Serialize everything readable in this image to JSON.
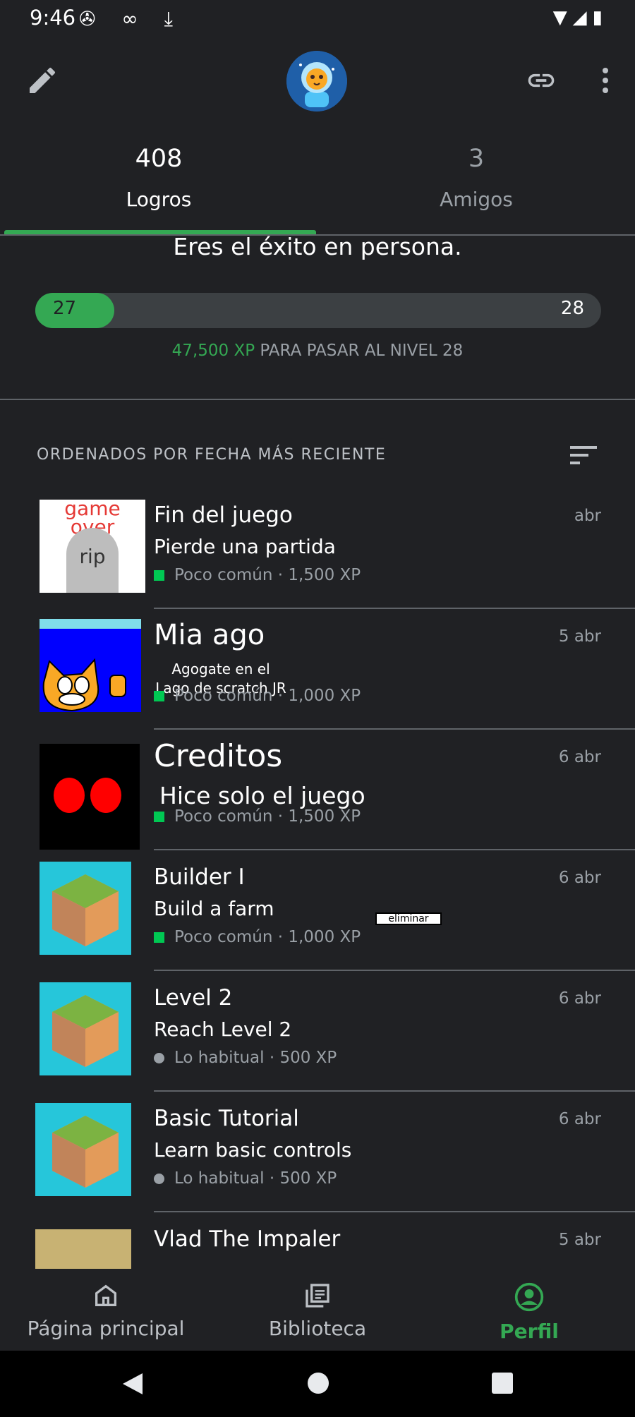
{
  "status_bar": {
    "time": "9:46",
    "left_icons": "✇ ∞ ⤓",
    "right_icons": "▼◢▮"
  },
  "app_bar": {
    "icons": [
      "edit-icon",
      "avatar",
      "link-icon",
      "more-vert-icon"
    ]
  },
  "tabs": [
    {
      "count": "408",
      "label": "Logros",
      "selected": true
    },
    {
      "count": "3",
      "label": "Amigos",
      "selected": false
    }
  ],
  "level": {
    "tagline": "Eres el éxito en persona.",
    "current": "27",
    "next": "28",
    "progress_fraction": 0.14,
    "xp_value": "47,500 XP",
    "xp_text": " PARA PASAR AL NIVEL 28"
  },
  "sort": {
    "label": "ORDENADOS POR FECHA MÁS RECIENTE"
  },
  "achievements": [
    {
      "title": "Fin del juego",
      "desc": "Pierde una partida",
      "rarity": "Poco común · 1,500 XP",
      "date": "abr",
      "thumb_text": "game over",
      "thumb_text2": "rip"
    },
    {
      "title": "Mia ago",
      "desc": "Agogate en el Lago de scratch JR",
      "rarity": "Poco común · 1,000 XP",
      "date": "5 abr"
    },
    {
      "title": "Creditos",
      "desc": "Hice solo el juego",
      "rarity": "Poco común · 1,500 XP",
      "date": "6 abr"
    },
    {
      "title": "Builder I",
      "desc": "Build a farm",
      "rarity": "Poco común · 1,000 XP",
      "date": "6 abr",
      "extra_label": "eliminar"
    },
    {
      "title": "Level 2",
      "desc": "Reach Level 2",
      "rarity": "Lo habitual · 500 XP",
      "date": "6 abr"
    },
    {
      "title": "Basic Tutorial",
      "desc": "Learn basic controls",
      "rarity": "Lo habitual · 500 XP",
      "date": "6 abr"
    },
    {
      "title": "Vlad The Impaler",
      "desc": "",
      "rarity": "",
      "date": "5 abr"
    }
  ],
  "bottom_nav": [
    {
      "label": "Página principal",
      "icon": "home-icon",
      "selected": false
    },
    {
      "label": "Biblioteca",
      "icon": "library-icon",
      "selected": false
    },
    {
      "label": "Perfil",
      "icon": "profile-icon",
      "selected": true
    }
  ],
  "colors": {
    "accent": "#34a853",
    "background": "#202124",
    "uncommon": "#00c853"
  }
}
